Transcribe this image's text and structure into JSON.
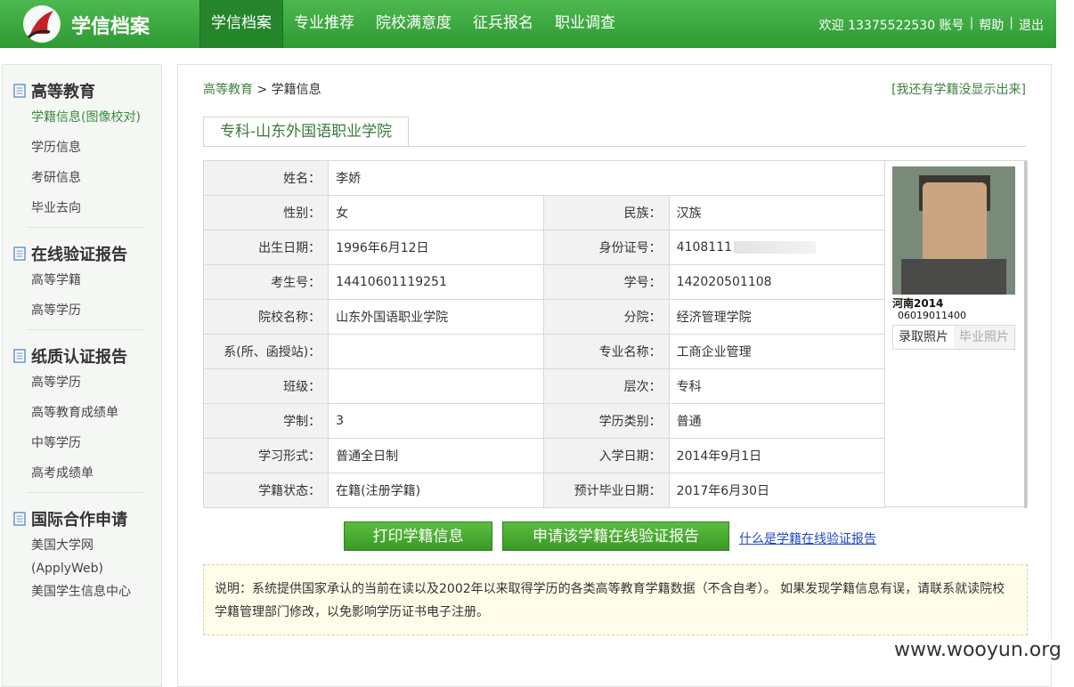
{
  "header": {
    "brand": "学信档案",
    "nav": [
      "学信档案",
      "专业推荐",
      "院校满意度",
      "征兵报名",
      "职业调查"
    ],
    "welcome": "欢迎 13375522530 账号",
    "help": "帮助",
    "logout": "退出",
    "sep": "|",
    "accent": "#3ca53f"
  },
  "sidebar": {
    "groups": [
      {
        "title": "高等教育",
        "items": [
          "学籍信息(图像校对)",
          "学历信息",
          "考研信息",
          "毕业去向"
        ]
      },
      {
        "title": "在线验证报告",
        "items": [
          "高等学籍",
          "高等学历"
        ]
      },
      {
        "title": "纸质认证报告",
        "items": [
          "高等学历",
          "高等教育成绩单",
          "中等学历",
          "高考成绩单"
        ]
      },
      {
        "title": "国际合作申请",
        "items": [
          "美国大学网",
          "(ApplyWeb)",
          "美国学生信息中心"
        ]
      }
    ]
  },
  "main": {
    "breadcrumb_root": "高等教育",
    "breadcrumb_sep": ">",
    "breadcrumb_current": "学籍信息",
    "missing_link": "[我还有学籍没显示出来]",
    "tab": "专科-山东外国语职业学院",
    "fields": {
      "name_label": "姓名：",
      "name": "李娇",
      "gender_label": "性别：",
      "gender": "女",
      "ethnicity_label": "民族：",
      "ethnicity": "汉族",
      "birth_label": "出生日期：",
      "birth": "1996年6月12日",
      "id_label": "身份证号：",
      "id": "4108111",
      "exam_label": "考生号：",
      "exam": "14410601119251",
      "student_label": "学号：",
      "student": "142020501108",
      "school_label": "院校名称：",
      "school": "山东外国语职业学院",
      "branch_label": "分院：",
      "branch": "经济管理学院",
      "dept_label": "系(所、函授站)：",
      "dept": "",
      "major_label": "专业名称：",
      "major": "工商企业管理",
      "class_label": "班级：",
      "class": "",
      "level_label": "层次：",
      "level": "专科",
      "duration_label": "学制：",
      "duration": "3",
      "degree_label": "学历类别：",
      "degree": "普通",
      "form_label": "学习形式：",
      "form": "普通全日制",
      "enroll_label": "入学日期：",
      "enroll": "2014年9月1日",
      "status_label": "学籍状态：",
      "status": "在籍(注册学籍)",
      "grad_label": "预计毕业日期：",
      "grad": "2017年6月30日"
    },
    "photo_caption": "河南2014",
    "photo_number": "06019011400",
    "photo_tab_admission": "录取照片",
    "photo_tab_graduation": "毕业照片",
    "btn_print": "打印学籍信息",
    "btn_apply": "申请该学籍在线验证报告",
    "what_link": "什么是学籍在线验证报告",
    "note": "说明：系统提供国家承认的当前在读以及2002年以来取得学历的各类高等教育学籍数据（不含自考）。 如果发现学籍信息有误，请联系就读院校学籍管理部门修改，以免影响学历证书电子注册。"
  },
  "watermark": "www.wooyun.org"
}
